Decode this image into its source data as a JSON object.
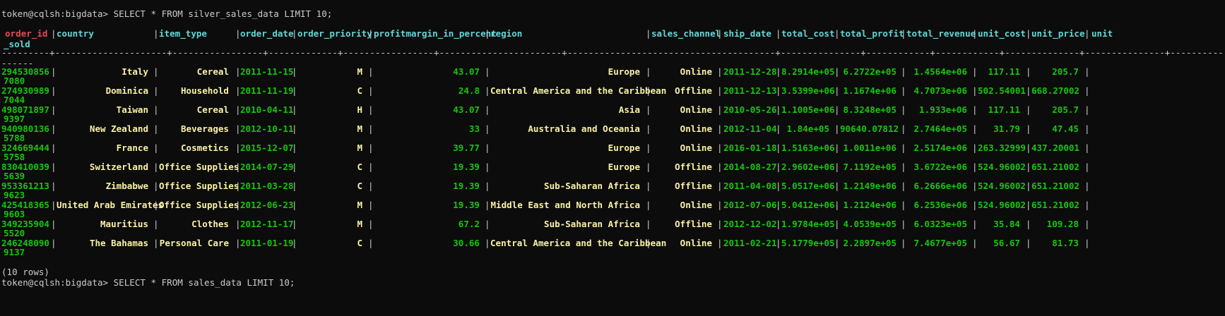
{
  "prompt1": "token@cqlsh:bigdata> SELECT * FROM silver_sales_data LIMIT 10;",
  "prompt2": "token@cqlsh:bigdata> SELECT * FROM sales_data LIMIT 10;",
  "row_count": "(10 rows)",
  "header": {
    "order_id": "order_id",
    "country": "country",
    "item_type": "item_type",
    "order_date": "order_date",
    "order_priority": "order_priority",
    "profitmargin_in_percent": "profitmargin_in_percent",
    "region": "region",
    "sales_channel": "sales_channel",
    "ship_date": "ship_date",
    "total_cost": "total_cost",
    "total_profit": "total_profit",
    "total_revenue": "total_revenue",
    "unit_cost": "unit_cost",
    "unit_price": "unit_price",
    "units_sold_start": "unit",
    "units_sold_end": "_sold"
  },
  "rows": [
    {
      "order_id": "294530856",
      "country": "Italy",
      "item_type": "Cereal",
      "order_date": "2011-11-15",
      "order_priority": "M",
      "profitmargin_in_percent": "43.07",
      "region": "Europe",
      "sales_channel": "Online",
      "ship_date": "2011-12-28",
      "total_cost": "8.2914e+05",
      "total_profit": "6.2722e+05",
      "total_revenue": "1.4564e+06",
      "unit_cost": "117.11",
      "unit_price": "205.7",
      "units_sold": "7080"
    },
    {
      "order_id": "274930989",
      "country": "Dominica",
      "item_type": "Household",
      "order_date": "2011-11-19",
      "order_priority": "C",
      "profitmargin_in_percent": "24.8",
      "region": "Central America and the Caribbean",
      "sales_channel": "Offline",
      "ship_date": "2011-12-13",
      "total_cost": "3.5399e+06",
      "total_profit": "1.1674e+06",
      "total_revenue": "4.7073e+06",
      "unit_cost": "502.54001",
      "unit_price": "668.27002",
      "units_sold": "7044"
    },
    {
      "order_id": "498071897",
      "country": "Taiwan",
      "item_type": "Cereal",
      "order_date": "2010-04-11",
      "order_priority": "H",
      "profitmargin_in_percent": "43.07",
      "region": "Asia",
      "sales_channel": "Online",
      "ship_date": "2010-05-26",
      "total_cost": "1.1005e+06",
      "total_profit": "8.3248e+05",
      "total_revenue": "1.933e+06",
      "unit_cost": "117.11",
      "unit_price": "205.7",
      "units_sold": "9397"
    },
    {
      "order_id": "940980136",
      "country": "New Zealand",
      "item_type": "Beverages",
      "order_date": "2012-10-11",
      "order_priority": "M",
      "profitmargin_in_percent": "33",
      "region": "Australia and Oceania",
      "sales_channel": "Online",
      "ship_date": "2012-11-04",
      "total_cost": "1.84e+05",
      "total_profit": "90640.07812",
      "total_revenue": "2.7464e+05",
      "unit_cost": "31.79",
      "unit_price": "47.45",
      "units_sold": "5788"
    },
    {
      "order_id": "324669444",
      "country": "France",
      "item_type": "Cosmetics",
      "order_date": "2015-12-07",
      "order_priority": "M",
      "profitmargin_in_percent": "39.77",
      "region": "Europe",
      "sales_channel": "Online",
      "ship_date": "2016-01-18",
      "total_cost": "1.5163e+06",
      "total_profit": "1.0011e+06",
      "total_revenue": "2.5174e+06",
      "unit_cost": "263.32999",
      "unit_price": "437.20001",
      "units_sold": "5758"
    },
    {
      "order_id": "830410039",
      "country": "Switzerland",
      "item_type": "Office Supplies",
      "order_date": "2014-07-29",
      "order_priority": "C",
      "profitmargin_in_percent": "19.39",
      "region": "Europe",
      "sales_channel": "Offline",
      "ship_date": "2014-08-27",
      "total_cost": "2.9602e+06",
      "total_profit": "7.1192e+05",
      "total_revenue": "3.6722e+06",
      "unit_cost": "524.96002",
      "unit_price": "651.21002",
      "units_sold": "5639"
    },
    {
      "order_id": "953361213",
      "country": "Zimbabwe",
      "item_type": "Office Supplies",
      "order_date": "2011-03-28",
      "order_priority": "C",
      "profitmargin_in_percent": "19.39",
      "region": "Sub-Saharan Africa",
      "sales_channel": "Offline",
      "ship_date": "2011-04-08",
      "total_cost": "5.0517e+06",
      "total_profit": "1.2149e+06",
      "total_revenue": "6.2666e+06",
      "unit_cost": "524.96002",
      "unit_price": "651.21002",
      "units_sold": "9623"
    },
    {
      "order_id": "425418365",
      "country": "United Arab Emirates",
      "item_type": "Office Supplies",
      "order_date": "2012-06-23",
      "order_priority": "M",
      "profitmargin_in_percent": "19.39",
      "region": "Middle East and North Africa",
      "sales_channel": "Online",
      "ship_date": "2012-07-06",
      "total_cost": "5.0412e+06",
      "total_profit": "1.2124e+06",
      "total_revenue": "6.2536e+06",
      "unit_cost": "524.96002",
      "unit_price": "651.21002",
      "units_sold": "9603"
    },
    {
      "order_id": "349235904",
      "country": "Mauritius",
      "item_type": "Clothes",
      "order_date": "2012-11-17",
      "order_priority": "M",
      "profitmargin_in_percent": "67.2",
      "region": "Sub-Saharan Africa",
      "sales_channel": "Offline",
      "ship_date": "2012-12-02",
      "total_cost": "1.9784e+05",
      "total_profit": "4.0539e+05",
      "total_revenue": "6.0323e+05",
      "unit_cost": "35.84",
      "unit_price": "109.28",
      "units_sold": "5520"
    },
    {
      "order_id": "246248090",
      "country": "The Bahamas",
      "item_type": "Personal Care",
      "order_date": "2011-01-19",
      "order_priority": "C",
      "profitmargin_in_percent": "30.66",
      "region": "Central America and the Caribbean",
      "sales_channel": "Online",
      "ship_date": "2011-02-21",
      "total_cost": "5.1779e+05",
      "total_profit": "2.2897e+05",
      "total_revenue": "7.4677e+05",
      "unit_cost": "56.67",
      "unit_price": "81.73",
      "units_sold": "9137"
    }
  ],
  "colors": {
    "background": "#0c0c0c",
    "text": "#cccccc",
    "partition_key": "#e74856",
    "column_header": "#61d6d6",
    "text_value": "#f9f1a5",
    "numeric_value": "#16c60c"
  }
}
